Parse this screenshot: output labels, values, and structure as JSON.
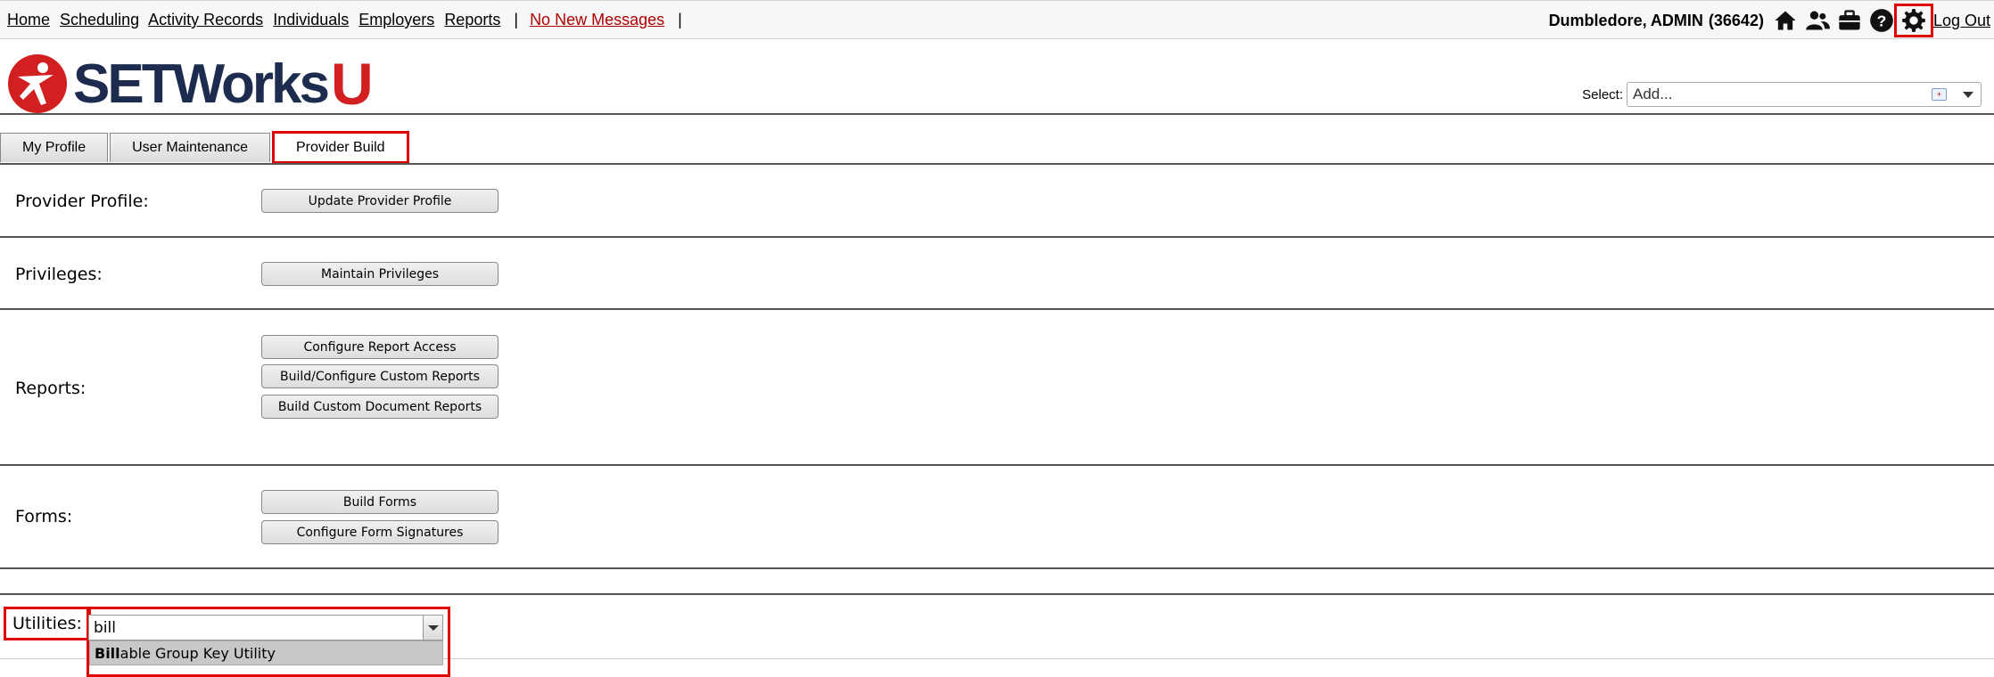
{
  "nav": {
    "items": [
      "Home",
      "Scheduling",
      "Activity Records",
      "Individuals",
      "Employers",
      "Reports"
    ],
    "separator": "|",
    "messages": "No New Messages"
  },
  "user": {
    "name": "Dumbledore, ADMIN",
    "id": "(36642)",
    "logout": "Log Out"
  },
  "icons": [
    "home-icon",
    "people-icon",
    "briefcase-icon",
    "help-icon",
    "gear-icon"
  ],
  "logo": {
    "text": "SETWorks",
    "suffix": "U"
  },
  "select": {
    "label": "Select:",
    "value": "Add..."
  },
  "tabs": [
    "My Profile",
    "User Maintenance",
    "Provider Build"
  ],
  "sections": {
    "provider_profile": {
      "label": "Provider Profile:",
      "buttons": [
        "Update Provider Profile"
      ]
    },
    "privileges": {
      "label": "Privileges:",
      "buttons": [
        "Maintain Privileges"
      ]
    },
    "reports": {
      "label": "Reports:",
      "buttons": [
        "Configure Report Access",
        "Build/Configure Custom Reports",
        "Build Custom Document Reports"
      ]
    },
    "forms": {
      "label": "Forms:",
      "buttons": [
        "Build Forms",
        "Configure Form Signatures"
      ]
    },
    "utilities": {
      "label": "Utilities:",
      "input_value": "bill",
      "suggestion_match": "Bill",
      "suggestion_rest": "able Group Key Utility"
    }
  },
  "colors": {
    "brand_navy": "#1d2b4f",
    "brand_red": "#d21f1f",
    "highlight": "#e00000",
    "messages": "#b00000"
  }
}
